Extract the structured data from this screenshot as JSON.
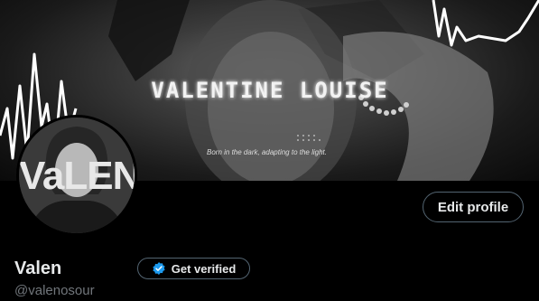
{
  "banner": {
    "title": "VALENTINE LOUISE",
    "tagline": "Born in the dark, adapting to the light."
  },
  "avatar": {
    "text": "VaLEN"
  },
  "actions": {
    "edit_profile": "Edit profile",
    "get_verified": "Get verified"
  },
  "profile": {
    "name": "Valen",
    "handle": "@valenosour"
  },
  "colors": {
    "verified_badge": "#1d9bf0",
    "button_border": "#536471",
    "muted_text": "#71767b"
  },
  "icons": {
    "verified": "verified-badge-icon"
  }
}
